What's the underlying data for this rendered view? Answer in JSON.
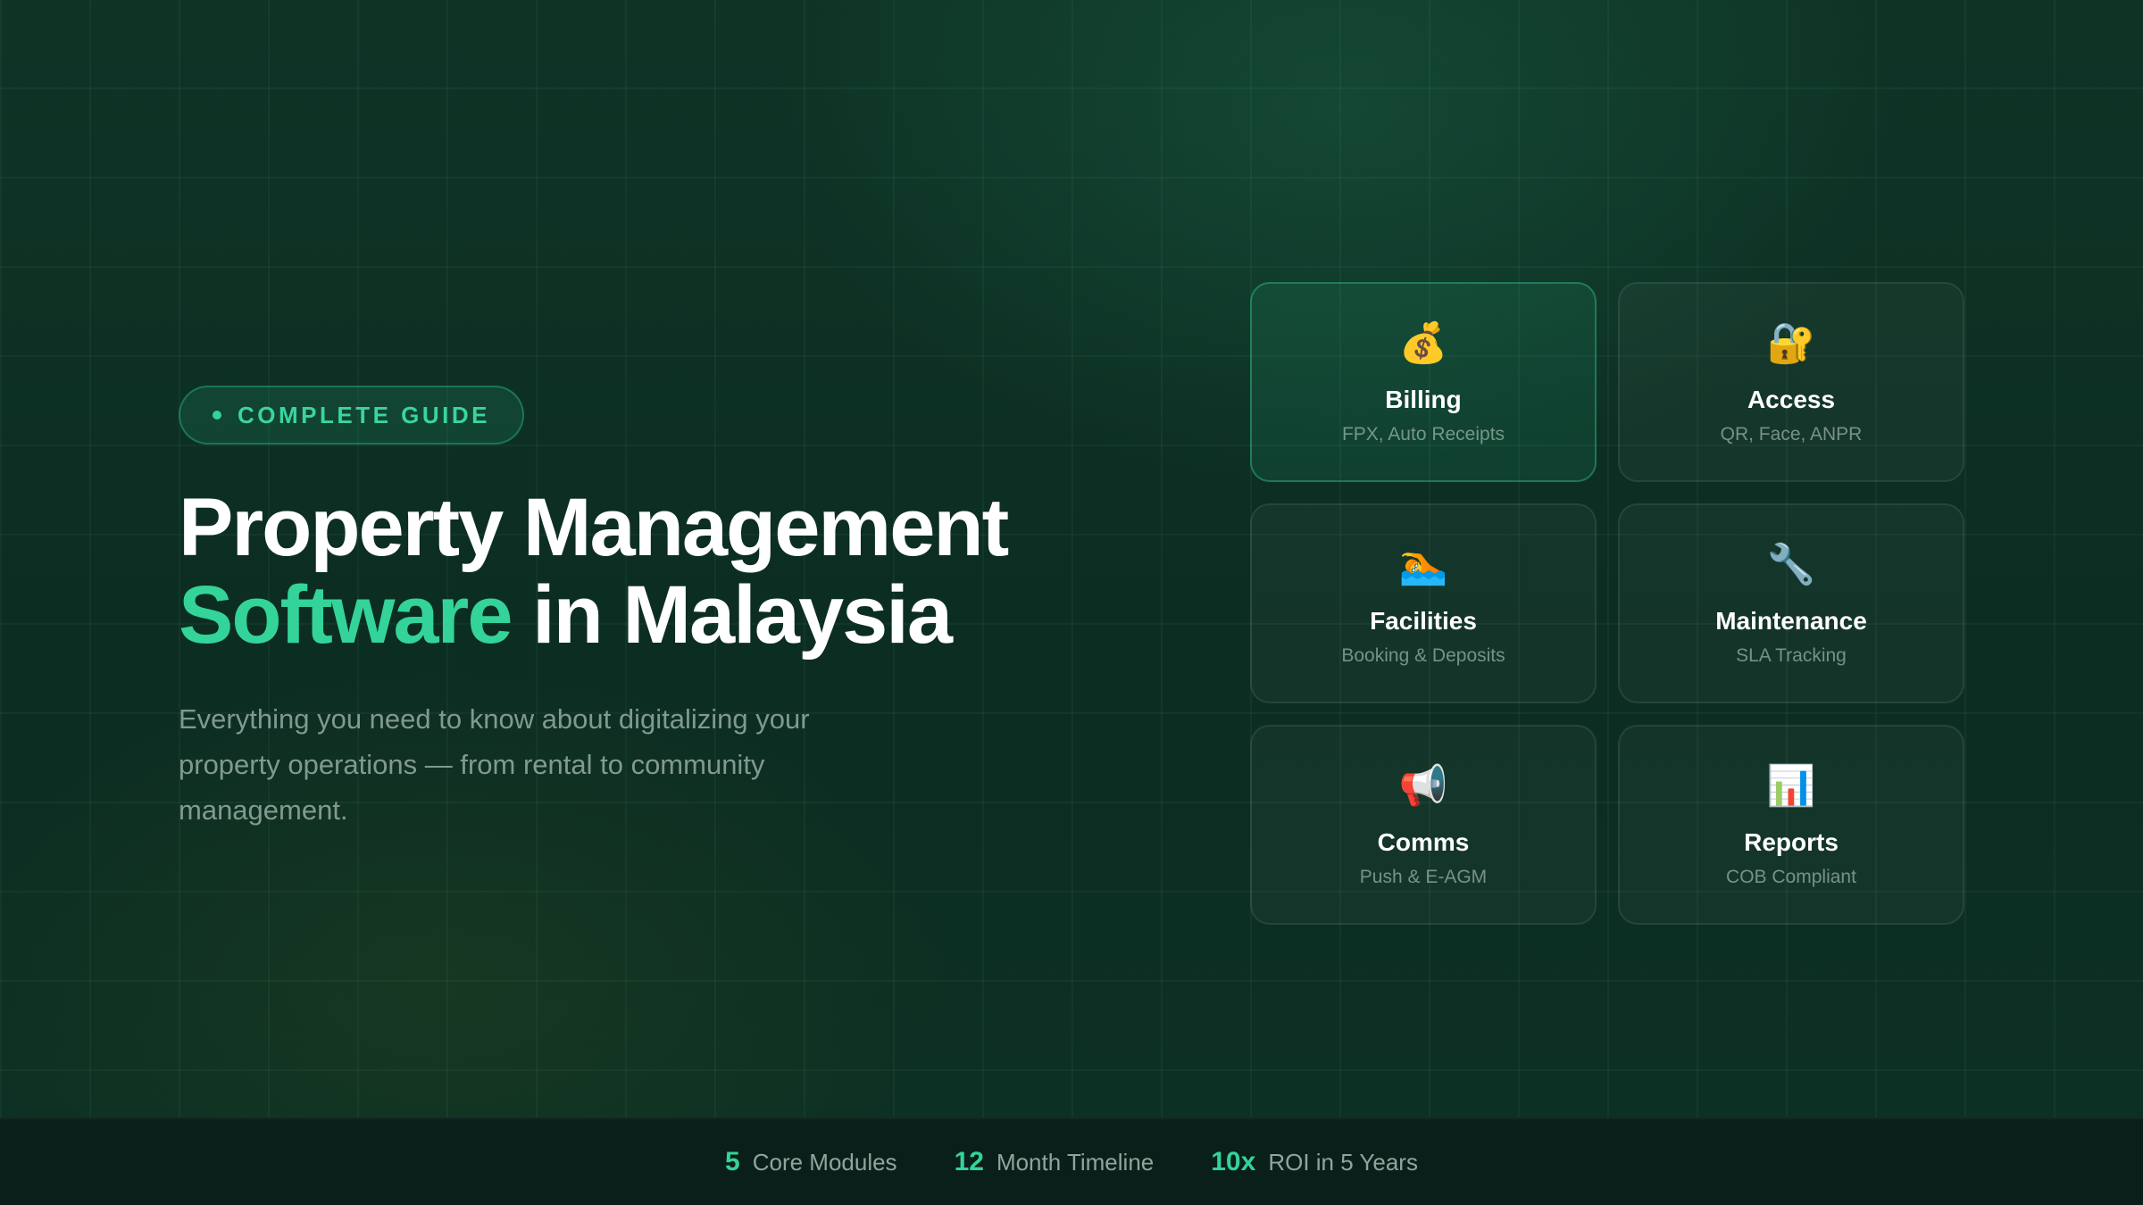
{
  "badge": {
    "label": "COMPLETE GUIDE"
  },
  "headline": {
    "line1": "Property Management",
    "line2_accent": "Software",
    "line2_rest": " in Malaysia"
  },
  "description": "Everything you need to know about digitalizing your property operations — from rental to community management.",
  "modules": [
    {
      "icon": "money-bag-icon",
      "glyph": "💰",
      "title": "Billing",
      "subtitle": "FPX, Auto Receipts",
      "active": true
    },
    {
      "icon": "lock-key-icon",
      "glyph": "🔐",
      "title": "Access",
      "subtitle": "QR, Face, ANPR",
      "active": false
    },
    {
      "icon": "swimmer-icon",
      "glyph": "🏊",
      "title": "Facilities",
      "subtitle": "Booking & Deposits",
      "active": false
    },
    {
      "icon": "wrench-icon",
      "glyph": "🔧",
      "title": "Maintenance",
      "subtitle": "SLA Tracking",
      "active": false
    },
    {
      "icon": "megaphone-icon",
      "glyph": "📢",
      "title": "Comms",
      "subtitle": "Push & E-AGM",
      "active": false
    },
    {
      "icon": "bar-chart-icon",
      "glyph": "📊",
      "title": "Reports",
      "subtitle": "COB Compliant",
      "active": false
    }
  ],
  "stats": [
    {
      "value": "5",
      "label": "Core Modules"
    },
    {
      "value": "12",
      "label": "Month Timeline"
    },
    {
      "value": "10x",
      "label": "ROI in 5 Years"
    }
  ],
  "colors": {
    "accent": "#34d399",
    "background": "#0d2c22",
    "footer": "#0a1f19"
  }
}
